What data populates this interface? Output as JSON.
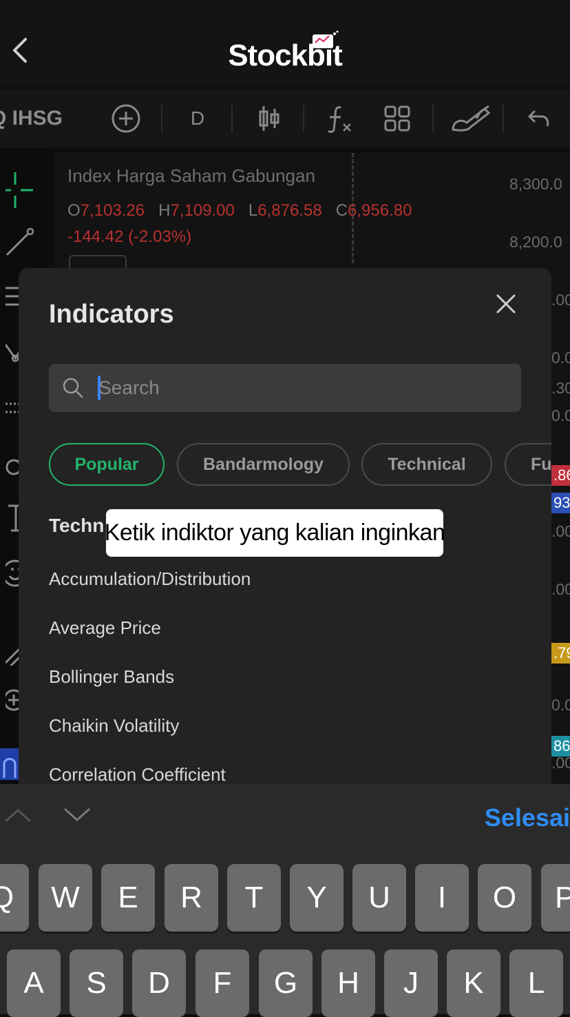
{
  "app": {
    "logo_text": "Stockbit"
  },
  "toolbar": {
    "symbol": "Q IHSG",
    "interval": "D"
  },
  "chart": {
    "title": "Index Harga Saham Gabungan",
    "ohlc": {
      "o_label": "O",
      "o": "7,103.26",
      "h_label": "H",
      "h": "7,109.00",
      "l_label": "L",
      "l": "6,876.58",
      "c_label": "C",
      "c": "6,956.80"
    },
    "change": "-144.42 (-2.03%)",
    "price_axis": [
      "8,300.0",
      "8,200.0",
      ".00",
      "0.0",
      ".30",
      "0.0",
      ".00",
      ".00",
      "0.0",
      ".00"
    ],
    "tags": [
      {
        "text": ".86",
        "color": "#c0303a"
      },
      {
        "text": "93",
        "color": "#2a4fb5"
      },
      {
        "text": ".79",
        "color": "#c89a1a"
      },
      {
        "text": "86",
        "color": "#1e8fa3"
      }
    ]
  },
  "modal": {
    "title": "Indicators",
    "search_placeholder": "Search",
    "chips": [
      "Popular",
      "Bandarmology",
      "Technical",
      "Fu"
    ],
    "active_chip": "Popular",
    "section_title": "Techn",
    "items": [
      "Accumulation/Distribution",
      "Average Price",
      "Bollinger Bands",
      "Chaikin Volatility",
      "Correlation Coefficient"
    ]
  },
  "tooltip": "Ketik indiktor yang kalian inginkan",
  "keyboard": {
    "done_label": "Selesai",
    "row1": [
      "Q",
      "W",
      "E",
      "R",
      "T",
      "Y",
      "U",
      "I",
      "O",
      "P"
    ],
    "row2": [
      "A",
      "S",
      "D",
      "F",
      "G",
      "H",
      "J",
      "K",
      "L"
    ]
  },
  "colors": {
    "accent_green": "#22b36a",
    "price_red": "#b8312f",
    "ios_blue": "#2f8cf5"
  }
}
